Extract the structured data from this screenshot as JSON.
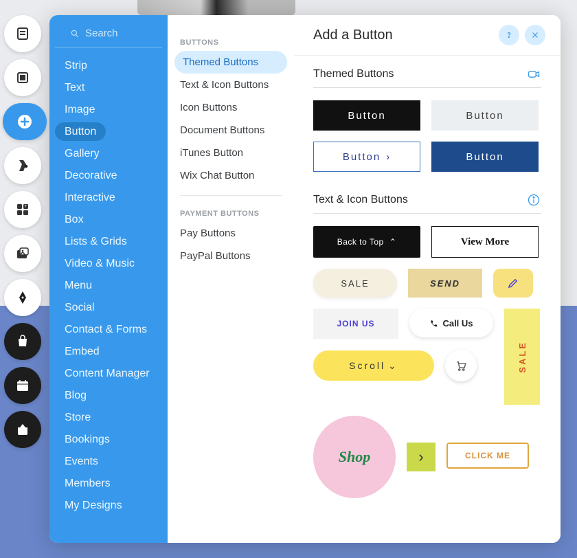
{
  "search": {
    "placeholder": "Search"
  },
  "categories": [
    "Strip",
    "Text",
    "Image",
    "Button",
    "Gallery",
    "Decorative",
    "Interactive",
    "Box",
    "Lists & Grids",
    "Video & Music",
    "Menu",
    "Social",
    "Contact & Forms",
    "Embed",
    "Content Manager",
    "Blog",
    "Store",
    "Bookings",
    "Events",
    "Members",
    "My Designs"
  ],
  "categories_active_index": 3,
  "sub": {
    "groups": [
      {
        "header": "BUTTONS",
        "items": [
          "Themed Buttons",
          "Text & Icon Buttons",
          "Icon Buttons",
          "Document Buttons",
          "iTunes Button",
          "Wix Chat Button"
        ],
        "active_index": 0
      },
      {
        "header": "PAYMENT BUTTONS",
        "items": [
          "Pay Buttons",
          "PayPal Buttons"
        ]
      }
    ]
  },
  "panel": {
    "title": "Add a Button"
  },
  "sections": {
    "themed": {
      "title": "Themed Buttons",
      "buttons": [
        "Button",
        "Button",
        "Button",
        "Button"
      ]
    },
    "text_icon": {
      "title": "Text & Icon Buttons",
      "back_to_top": "Back to Top",
      "view_more": "View More",
      "sale": "SALE",
      "send": "SEND",
      "join_us": "JOIN US",
      "call_us": "Call Us",
      "sale_vertical": "SALE",
      "scroll": "Scroll",
      "shop": "Shop",
      "click_me": "CLICK ME"
    }
  }
}
